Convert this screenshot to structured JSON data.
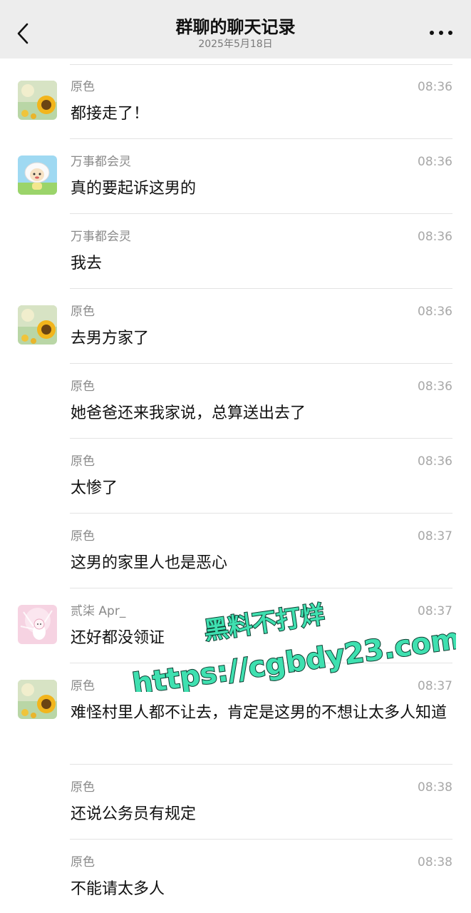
{
  "header": {
    "title": "群聊的聊天记录",
    "date": "2025年5月18日",
    "back_icon": "chevron-left-icon",
    "more_icon": "more-dots-icon"
  },
  "messages": [
    {
      "sender": "原色",
      "time": "08:36",
      "text": "都接走了！",
      "avatar": "sunflower"
    },
    {
      "sender": "万事都会灵",
      "time": "08:36",
      "text": "真的要起诉这男的",
      "avatar": "sheep"
    },
    {
      "sender": "万事都会灵",
      "time": "08:36",
      "text": "我去",
      "avatar": ""
    },
    {
      "sender": "原色",
      "time": "08:36",
      "text": "去男方家了",
      "avatar": "sunflower"
    },
    {
      "sender": "原色",
      "time": "08:36",
      "text": "她爸爸还来我家说，总算送出去了",
      "avatar": ""
    },
    {
      "sender": "原色",
      "time": "08:36",
      "text": "太惨了",
      "avatar": ""
    },
    {
      "sender": "原色",
      "time": "08:37",
      "text": "这男的家里人也是恶心",
      "avatar": ""
    },
    {
      "sender": "贰柒 Apr_",
      "time": "08:37",
      "text": "还好都没领证",
      "avatar": "pink-character"
    },
    {
      "sender": "原色",
      "time": "08:37",
      "text": "难怪村里人都不让去，肯定是这男的不想让太多人知道",
      "avatar": "sunflower"
    },
    {
      "sender": "原色",
      "time": "08:38",
      "text": "还说公务员有规定",
      "avatar": ""
    },
    {
      "sender": "原色",
      "time": "08:38",
      "text": "不能请太多人",
      "avatar": ""
    }
  ],
  "watermark": {
    "line1": "黑料不打烊",
    "line2": "https://cgbdy23.com",
    "color": "#3fe0b0"
  }
}
